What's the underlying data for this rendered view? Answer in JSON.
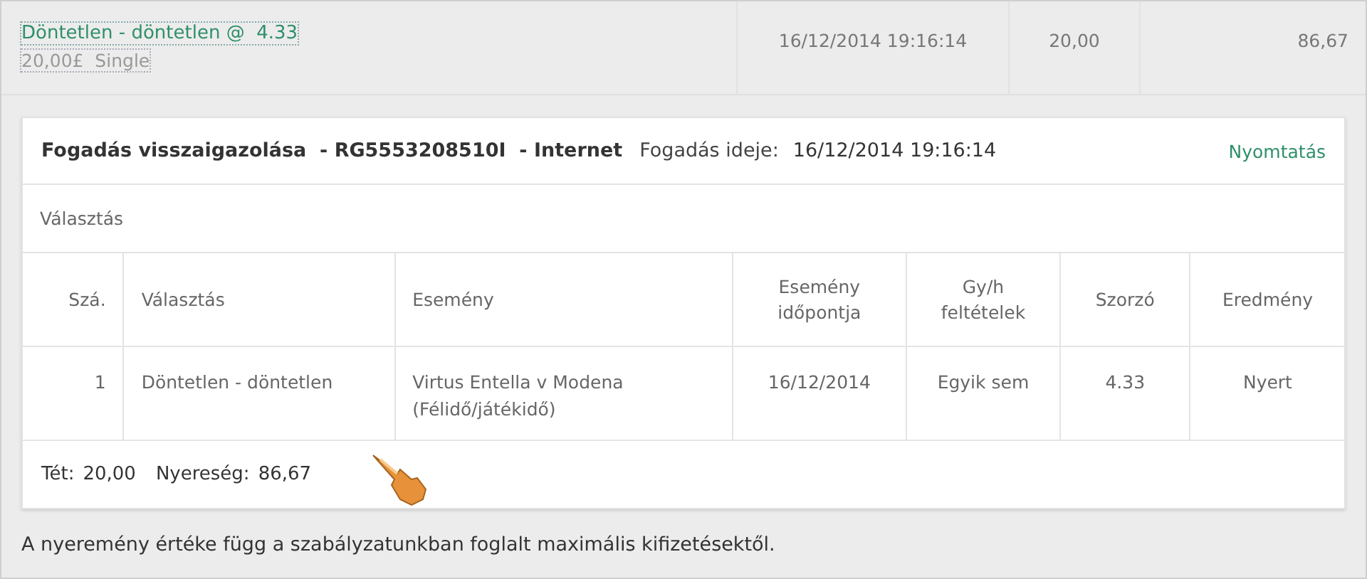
{
  "bet_row": {
    "selection": "Döntetlen - döntetlen @  4.33",
    "stake_type": "20,00£  Single",
    "date": "16/12/2014 19:16:14",
    "stake": "20,00",
    "return": "86,67"
  },
  "confirmation": {
    "title": "Fogadás visszaigazolása  - RG5553208510I  - Internet",
    "time_label": "Fogadás ideje:",
    "time": "16/12/2014 19:16:14",
    "print_link": "Nyomtatás",
    "section_label": "Választás",
    "table": {
      "columns": [
        "Szá.",
        "Választás",
        "Esemény",
        "Esemény időpontja",
        "Gy/h feltételek",
        "Szorzó",
        "Eredmény"
      ],
      "rows": [
        [
          "1",
          "Döntetlen - döntetlen",
          "Virtus Entella v Modena (Félidő/játékidő)",
          "16/12/2014",
          "Egyik sem",
          "4.33",
          "Nyert"
        ]
      ]
    },
    "totals": [
      {
        "label": "Tét:",
        "value": "20,00"
      },
      {
        "label": "Nyereség:",
        "value": "86,67"
      }
    ]
  },
  "note": "A nyeremény értéke függ a szabályzatunkban foglalt maximális kifizetésektől."
}
